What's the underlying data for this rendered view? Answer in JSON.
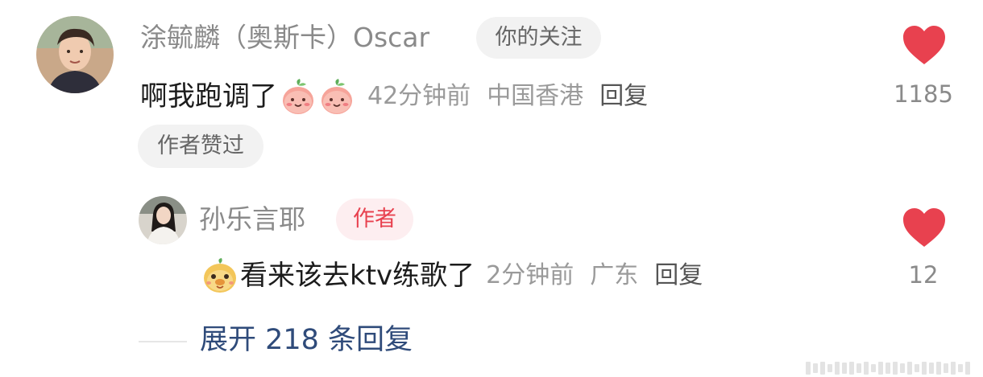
{
  "comment": {
    "username": "涂毓麟（奥斯卡）Oscar",
    "follow_tag": "你的关注",
    "text": "啊我跑调了",
    "time": "42分钟前",
    "location": "中国香港",
    "reply_label": "回复",
    "author_liked_tag": "作者赞过",
    "like_count": "1185",
    "like_color": "#e8414f"
  },
  "reply": {
    "username": "孙乐言耶",
    "author_tag": "作者",
    "text": "看来该去ktv练歌了",
    "time": "2分钟前",
    "location": "广东",
    "reply_label": "回复",
    "like_count": "12"
  },
  "expand": {
    "label": "展开 218 条回复"
  },
  "icons": {
    "heart": "heart-icon",
    "emoji_peach": "peach-emoji-icon",
    "emoji_chick": "chick-emoji-icon"
  }
}
